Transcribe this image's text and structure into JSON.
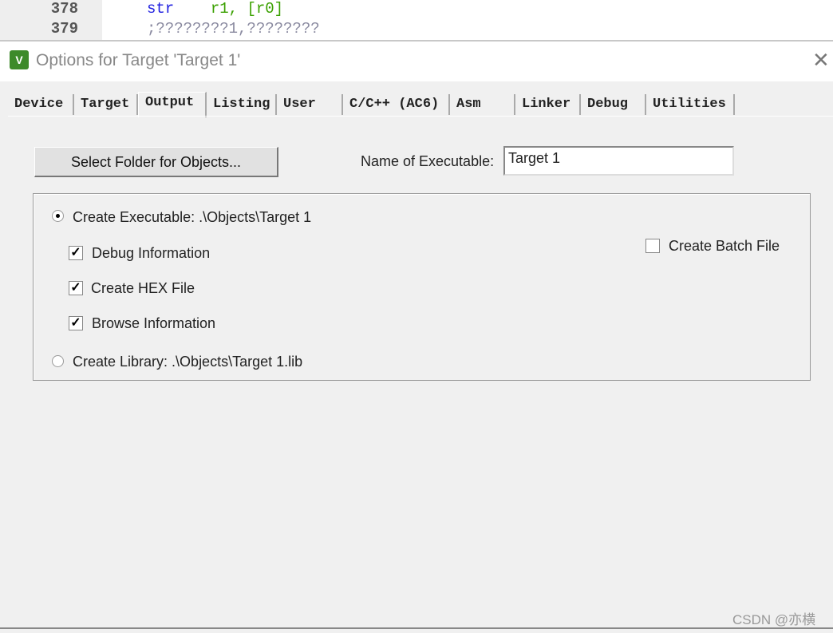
{
  "editor": {
    "lines": [
      {
        "number": "378",
        "tokens": [
          {
            "text": "str",
            "color": "#2020e0"
          },
          {
            "text": "    r1, ",
            "color": "#3aa000"
          },
          {
            "text": "[r0]",
            "color": "#3aa000"
          }
        ]
      },
      {
        "number": "379",
        "tokens": [
          {
            "text": ";????????1,????????",
            "color": "#8a8aa0"
          }
        ]
      }
    ]
  },
  "dialog": {
    "title": "Options for Target 'Target 1'",
    "app_icon": "keil-uvision-icon",
    "close_icon": "✕",
    "tabs": [
      "Device",
      "Target",
      "Output",
      "Listing",
      "User",
      "C/C++ (AC6)",
      "Asm",
      "Linker",
      "Debug",
      "Utilities"
    ],
    "active_tab": "Output",
    "select_folder_label": "Select Folder for Objects...",
    "name_label": "Name of Executable:",
    "name_value": "Target 1",
    "create_executable": {
      "label": "Create Executable:  .\\Objects\\Target 1",
      "selected": true
    },
    "debug_info": {
      "label": "Debug Information",
      "checked": true
    },
    "create_hex": {
      "label": "Create HEX File",
      "checked": true
    },
    "browse_info": {
      "label": "Browse Information",
      "checked": true
    },
    "create_library": {
      "label": "Create Library:  .\\Objects\\Target 1.lib",
      "selected": false
    },
    "create_batch": {
      "label": "Create Batch File",
      "checked": false
    }
  },
  "watermark": "CSDN @亦横"
}
